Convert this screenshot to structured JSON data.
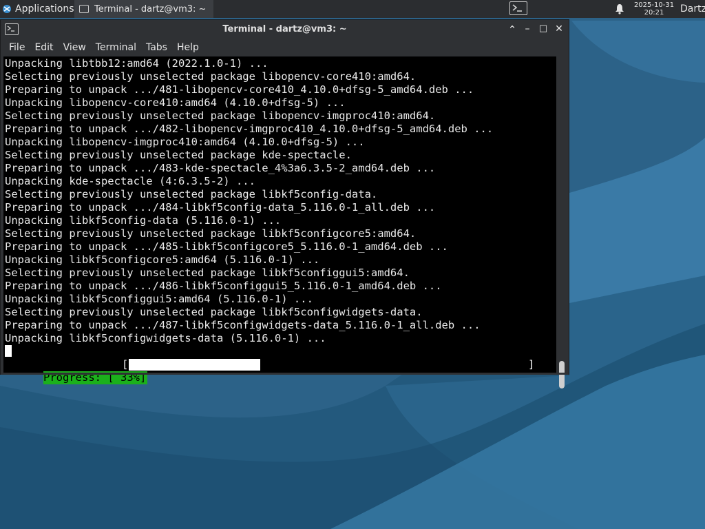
{
  "panel": {
    "applications_label": "Applications",
    "menu_glyph": "☰",
    "task_label": "Terminal - dartz@vm3: ~",
    "clock_date": "2025-10-31",
    "clock_time": "20:21",
    "user": "Dartz"
  },
  "window": {
    "title": "Terminal - dartz@vm3: ~",
    "controls": {
      "shade": "⌃",
      "minimize": "–",
      "maximize": "□",
      "close": "✕"
    },
    "menu": [
      "File",
      "Edit",
      "View",
      "Terminal",
      "Tabs",
      "Help"
    ]
  },
  "terminal": {
    "lines": [
      "Unpacking libtbb12:amd64 (2022.1.0-1) ...",
      "Selecting previously unselected package libopencv-core410:amd64.",
      "Preparing to unpack .../481-libopencv-core410_4.10.0+dfsg-5_amd64.deb ...",
      "Unpacking libopencv-core410:amd64 (4.10.0+dfsg-5) ...",
      "Selecting previously unselected package libopencv-imgproc410:amd64.",
      "Preparing to unpack .../482-libopencv-imgproc410_4.10.0+dfsg-5_amd64.deb ...",
      "Unpacking libopencv-imgproc410:amd64 (4.10.0+dfsg-5) ...",
      "Selecting previously unselected package kde-spectacle.",
      "Preparing to unpack .../483-kde-spectacle_4%3a6.3.5-2_amd64.deb ...",
      "Unpacking kde-spectacle (4:6.3.5-2) ...",
      "Selecting previously unselected package libkf5config-data.",
      "Preparing to unpack .../484-libkf5config-data_5.116.0-1_all.deb ...",
      "Unpacking libkf5config-data (5.116.0-1) ...",
      "Selecting previously unselected package libkf5configcore5:amd64.",
      "Preparing to unpack .../485-libkf5configcore5_5.116.0-1_amd64.deb ...",
      "Unpacking libkf5configcore5:amd64 (5.116.0-1) ...",
      "Selecting previously unselected package libkf5configgui5:amd64.",
      "Preparing to unpack .../486-libkf5configgui5_5.116.0-1_amd64.deb ...",
      "Unpacking libkf5configgui5:amd64 (5.116.0-1) ...",
      "Selecting previously unselected package libkf5configwidgets-data.",
      "Preparing to unpack .../487-libkf5configwidgets-data_5.116.0-1_all.deb ...",
      "Unpacking libkf5configwidgets-data (5.116.0-1) ..."
    ],
    "progress_label": "Progress: [ 33%]",
    "progress_fraction": 0.33,
    "bracket_left": "[",
    "bracket_right": "]"
  },
  "colors": {
    "progress_green": "#1bb01b",
    "terminal_bg": "#000000",
    "panel_bg": "#2b2d30"
  }
}
